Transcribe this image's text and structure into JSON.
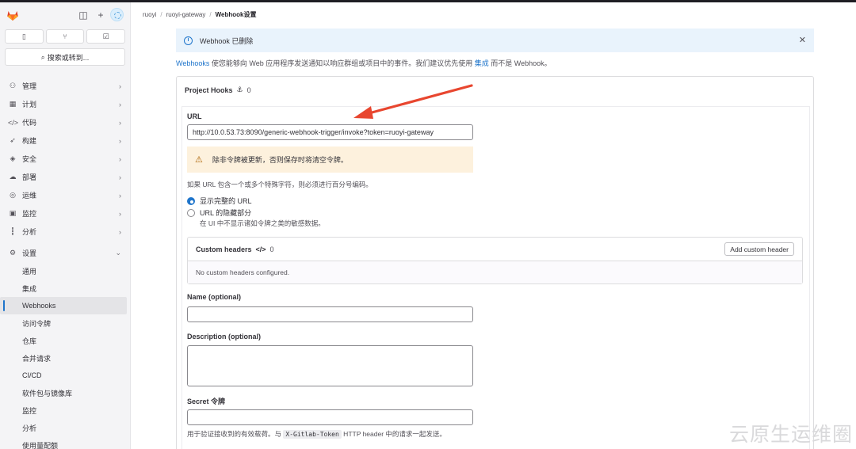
{
  "sidebar": {
    "search_label": "搜索或转到...",
    "items": [
      {
        "label": "管理",
        "icon": "users-icon",
        "glyph": "⚇"
      },
      {
        "label": "计划",
        "icon": "calendar-icon",
        "glyph": "▦"
      },
      {
        "label": "代码",
        "icon": "code-icon",
        "glyph": "</>"
      },
      {
        "label": "构建",
        "icon": "rocket-icon",
        "glyph": "➶"
      },
      {
        "label": "安全",
        "icon": "shield-icon",
        "glyph": "◈"
      },
      {
        "label": "部署",
        "icon": "deploy-icon",
        "glyph": "☁"
      },
      {
        "label": "运维",
        "icon": "operate-icon",
        "glyph": "◎"
      },
      {
        "label": "监控",
        "icon": "monitor-icon",
        "glyph": "▣"
      },
      {
        "label": "分析",
        "icon": "chart-icon",
        "glyph": "┇"
      },
      {
        "label": "设置",
        "icon": "settings-icon",
        "glyph": "⚙"
      }
    ],
    "settings_subitems": [
      "通用",
      "集成",
      "Webhooks",
      "访问令牌",
      "仓库",
      "合并请求",
      "CI/CD",
      "软件包与镜像库",
      "监控",
      "分析",
      "使用量配额"
    ],
    "active_subitem": "Webhooks"
  },
  "breadcrumb": [
    "ruoyi",
    "ruoyi-gateway",
    "Webhook设置"
  ],
  "alert": {
    "text": "Webhook 已删除"
  },
  "intro": {
    "link1": "Webhooks",
    "text1": " 使您能够向 Web 应用程序发送通知以响应群组或项目中的事件。我们建议优先使用 ",
    "link2": "集成",
    "text2": " 而不是 Webhook。"
  },
  "project_hooks": {
    "title": "Project Hooks",
    "count": "0"
  },
  "form": {
    "url_label": "URL",
    "url_value": "http://10.0.53.73:8090/generic-webhook-trigger/invoke?token=ruoyi-gateway",
    "warning": "除非令牌被更新，否则保存时将清空令牌。",
    "url_help": "如果 URL 包含一个或多个特殊字符，则必须进行百分号编码。",
    "radio_full": "显示完整的 URL",
    "radio_hidden": "URL 的隐藏部分",
    "radio_hidden_help": "在 UI 中不显示诸如令牌之类的敏感数据。",
    "custom_headers_title": "Custom headers",
    "custom_headers_count": "0",
    "add_custom_header": "Add custom header",
    "no_custom_headers": "No custom headers configured.",
    "name_label": "Name (optional)",
    "description_label": "Description (optional)",
    "secret_label": "Secret 令牌",
    "secret_help_pre": "用于验证接收到的有效载荷。与 ",
    "secret_help_code": "X-Gitlab-Token",
    "secret_help_post": " HTTP header 中的请求一起发送。"
  },
  "watermark": "云原生运维圈",
  "colors": {
    "accent": "#1f75cb",
    "arrow": "#e8462f",
    "warning_bg": "#fdf1dd",
    "alert_bg": "#e9f3fc"
  }
}
